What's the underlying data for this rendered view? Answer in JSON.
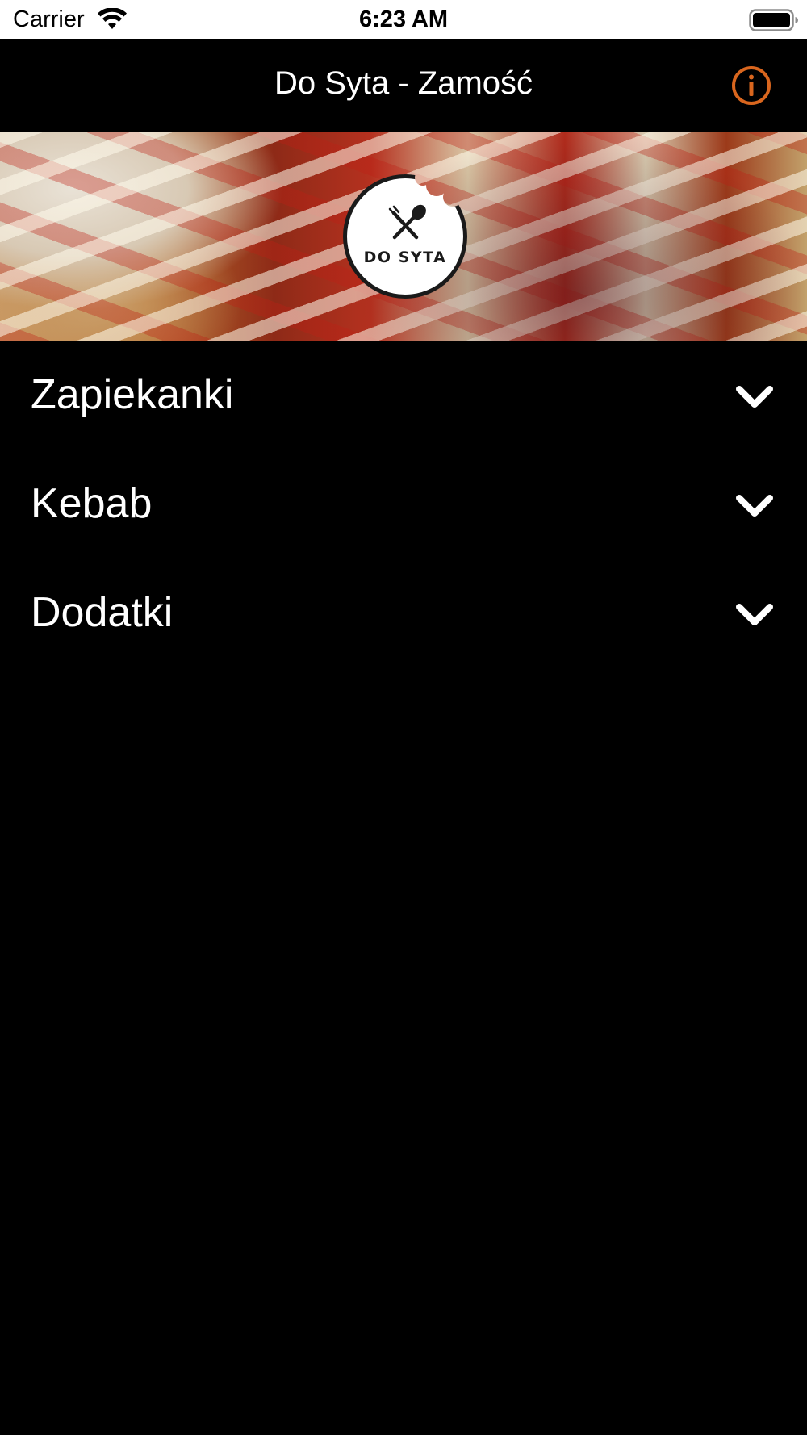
{
  "status_bar": {
    "carrier": "Carrier",
    "time": "6:23 AM",
    "wifi_icon": "wifi-icon",
    "battery_icon": "battery-full-icon"
  },
  "nav": {
    "title": "Do Syta - Zamość",
    "info_icon": "info-circle-icon",
    "accent_color": "#D9661E"
  },
  "hero": {
    "logo_text": "DO SYTA",
    "logo_icon": "fork-spoon-icon"
  },
  "menu": {
    "items": [
      {
        "label": "Zapiekanki",
        "icon": "chevron-down-icon"
      },
      {
        "label": "Kebab",
        "icon": "chevron-down-icon"
      },
      {
        "label": "Dodatki",
        "icon": "chevron-down-icon"
      }
    ]
  }
}
